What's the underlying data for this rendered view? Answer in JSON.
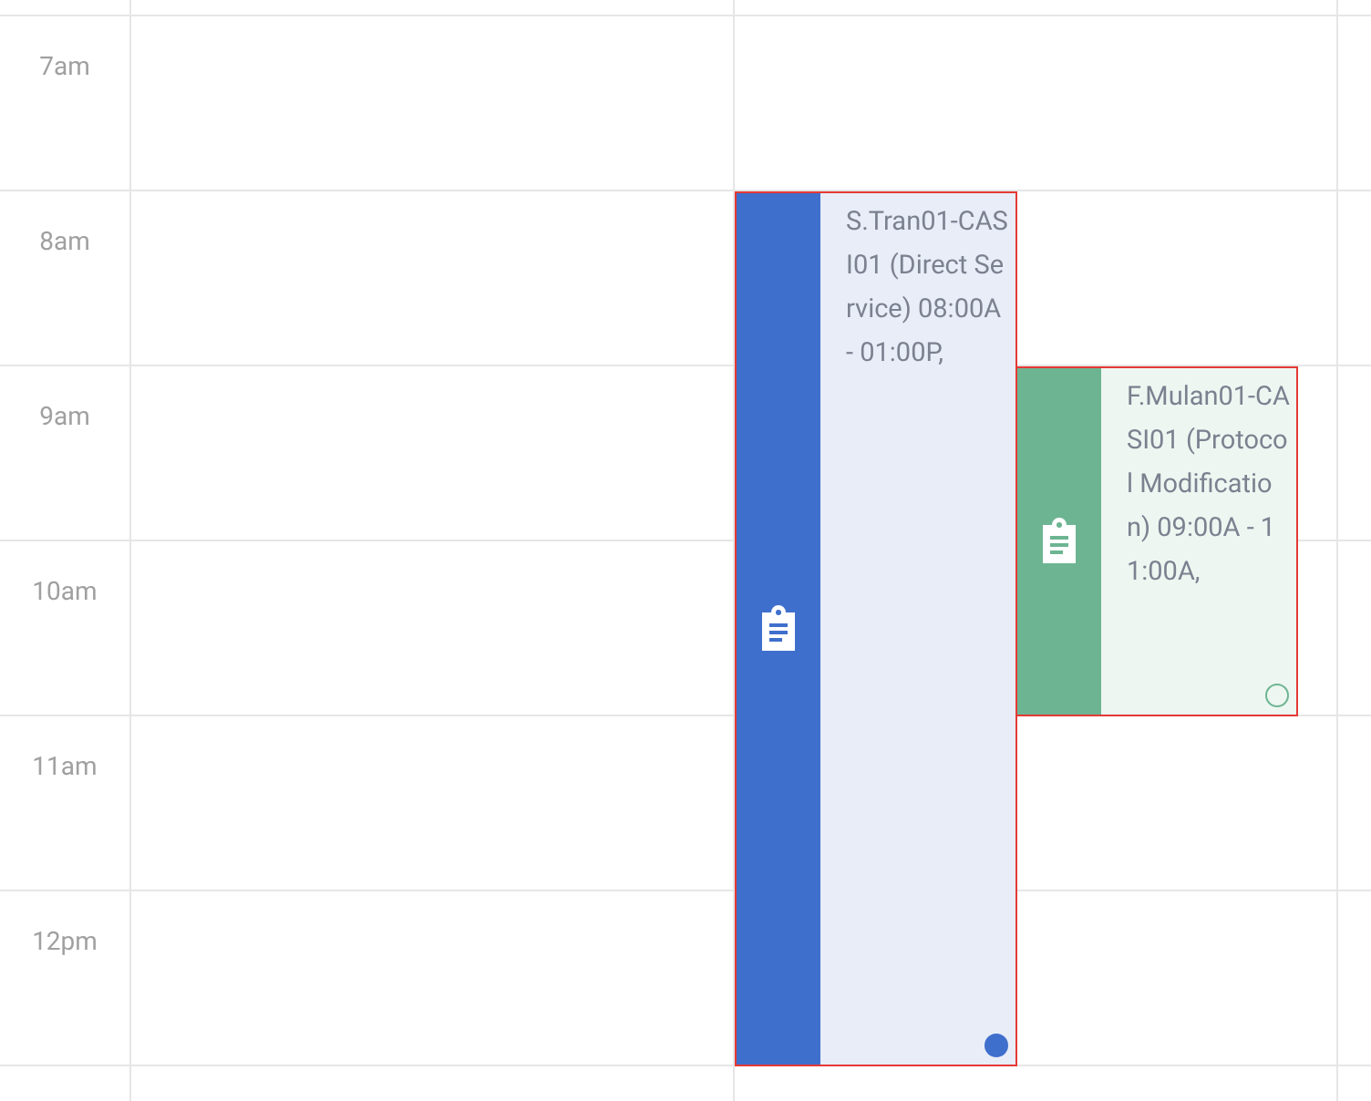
{
  "hours": [
    "7am",
    "8am",
    "9am",
    "10am",
    "11am",
    "12pm"
  ],
  "events": [
    {
      "title": "S.Tran01-CASI01 (Direct Service) 08:00A - 01:00P,",
      "color": "#3f6fcc",
      "kind": "filled"
    },
    {
      "title": "F.Mulan01-CASI01 (Protocol Modification) 09:00A - 11:00A,",
      "color": "#6db592",
      "kind": "hollow"
    }
  ]
}
